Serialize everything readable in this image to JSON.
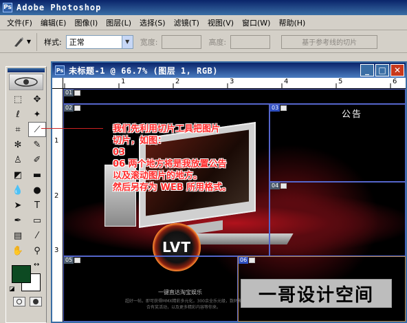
{
  "app": {
    "title": "Adobe Photoshop",
    "icon": "photoshop-icon"
  },
  "menu": {
    "items": [
      "文件(F)",
      "编辑(E)",
      "图像(I)",
      "图层(L)",
      "选择(S)",
      "滤镜(T)",
      "视图(V)",
      "窗口(W)",
      "帮助(H)"
    ]
  },
  "options": {
    "style_label": "样式:",
    "style_value": "正常",
    "width_label": "宽度:",
    "height_label": "高度:",
    "guides_button": "基于参考线的切片"
  },
  "toolbox": {
    "tools": [
      "marquee-tool",
      "move-tool",
      "lasso-tool",
      "magic-wand-tool",
      "crop-tool",
      "slice-tool",
      "healing-brush-tool",
      "brush-tool",
      "clone-stamp-tool",
      "history-brush-tool",
      "eraser-tool",
      "gradient-tool",
      "blur-tool",
      "dodge-tool",
      "path-selection-tool",
      "type-tool",
      "pen-tool",
      "shape-tool",
      "notes-tool",
      "eyedropper-tool",
      "hand-tool",
      "zoom-tool"
    ],
    "active_tool": "slice-tool",
    "foreground_color": "#0d4a22",
    "background_color": "#ffffff"
  },
  "document": {
    "title": "未标题-1 @ 66.7% (图层 1, RGB)",
    "ruler_top": [
      "1",
      "2",
      "3",
      "4",
      "5",
      "6"
    ],
    "ruler_left": [
      "1",
      "2",
      "3"
    ],
    "annotation": "我们先利用切片工具把图片\n切片，如图：\n03\n06 两个地方将是我放置公告\n以及滚动图片的地方。\n然后另存为 WEB 所用格式。",
    "notice_title": "公告",
    "logo_text": "LVT",
    "tagline": "一键直达淘宝娱乐",
    "tagline_small": "超好一帖，即可获得MMX精彩多元化，300余全乐元级，数码聚合有奖活动，以及更多精彩内容等你来。",
    "slices": [
      {
        "id": "01",
        "blue": false
      },
      {
        "id": "02",
        "blue": false
      },
      {
        "id": "03",
        "blue": true
      },
      {
        "id": "04",
        "blue": false
      },
      {
        "id": "05",
        "blue": false
      },
      {
        "id": "06",
        "blue": true
      }
    ]
  },
  "watermark": "一哥设计空间"
}
